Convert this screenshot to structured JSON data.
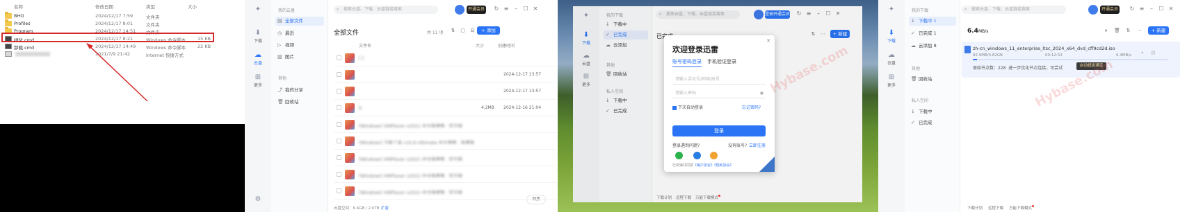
{
  "explorer": {
    "columns": [
      "名称",
      "修改日期",
      "类型",
      "大小"
    ],
    "rows": [
      {
        "name": "BHO",
        "date": "2024/12/17 7:59",
        "type": "文件夹",
        "size": "",
        "icon": "folder-icon"
      },
      {
        "name": "Profiles",
        "date": "2024/12/17 8:01",
        "type": "文件夹",
        "size": "",
        "icon": "folder-icon"
      },
      {
        "name": "Program",
        "date": "2024/12/17 14:51",
        "type": "文件夹",
        "size": "",
        "icon": "folder-icon"
      },
      {
        "name": "绿化.cmd",
        "date": "2024/12/17 8:21",
        "type": "Windows 命令脚本",
        "size": "15 KB",
        "icon": "cmd-icon"
      },
      {
        "name": "卸载.cmd",
        "date": "2024/12/17 14:49",
        "type": "Windows 命令脚本",
        "size": "22 KB",
        "icon": "cmd-icon"
      },
      {
        "name": "",
        "date": "2021/7/9 21:42",
        "type": "Internet 快捷方式",
        "size": "",
        "icon": "shortcut-icon"
      }
    ],
    "highlight_color": "#d62a2a"
  },
  "sidebar": {
    "items": [
      {
        "label": "下载",
        "icon": "download-icon"
      },
      {
        "label": "云盘",
        "icon": "cloud-icon"
      },
      {
        "label": "更多",
        "icon": "grid-icon"
      }
    ]
  },
  "cloud": {
    "nav_section": "我的云盘",
    "nav": [
      {
        "label": "全部文件",
        "icon": "folder-icon"
      },
      {
        "label": "最近",
        "icon": "clock-icon"
      },
      {
        "label": "视频",
        "icon": "video-icon"
      },
      {
        "label": "图片",
        "icon": "image-icon"
      }
    ],
    "nav_section2": "其他",
    "nav2": [
      {
        "label": "我的分享",
        "icon": "share-icon"
      },
      {
        "label": "回收站",
        "icon": "trash-icon"
      }
    ],
    "search_placeholder": "搜索云盘、下载、云盘链接搜索",
    "vip_label": "开通会员",
    "title": "全部文件",
    "count": "共 11 项",
    "add_label": "+ 添加",
    "col_name": "文件名",
    "col_size": "大小",
    "col_date": "创建时间",
    "files": [
      {
        "name": "[ ]",
        "size": "",
        "date": ""
      },
      {
        "name": "",
        "size": "",
        "date": "2024-12-17 13:57"
      },
      {
        "name": "",
        "size": "",
        "date": "2024-12-17 13:57"
      },
      {
        "name": "b",
        "size": "4.2MB",
        "date": "2024-12-16 21:04"
      },
      {
        "name": "[Windows] XMPlayer v2021 中文版便携 · 官方版",
        "size": "",
        "date": ""
      },
      {
        "name": "[Windows] 万能工具 v10.6 Ultimate 中文便携 · 免费版",
        "size": "",
        "date": ""
      },
      {
        "name": "[Windows] XMPlayer v2021 中文版便携 · 官方版",
        "size": "",
        "date": ""
      },
      {
        "name": "[Windows] XMPlayer v2021 中文版便携 · 官方版",
        "size": "",
        "date": ""
      },
      {
        "name": "[Windows] XMPlayer v2021 中文版便携 · 官方版",
        "size": "",
        "date": ""
      }
    ],
    "storage": "云盘空间：6.6GB / 2.0TB",
    "expand": "扩容",
    "up_label": "回顶"
  },
  "download_nav": {
    "section": "我的下载",
    "items": [
      {
        "label": "下载中",
        "count": "1",
        "icon": "arrow-down-icon"
      },
      {
        "label": "已完成",
        "count": "1",
        "icon": "check-circle-icon"
      },
      {
        "label": "云添加",
        "count": "8",
        "icon": "cloud-add-icon"
      }
    ],
    "other_section": "其他",
    "trash": "回收站",
    "private_section": "私人空间",
    "private_items": [
      {
        "label": "下载中",
        "icon": "arrow-down-icon"
      },
      {
        "label": "已完成",
        "icon": "check-circle-icon"
      }
    ]
  },
  "login": {
    "section_title": "已完成",
    "search_placeholder": "搜索云盘、下载、云盘链接搜索",
    "vip_label": "登录开通会员",
    "dialog_title": "欢迎登录迅雷",
    "tab_password": "账号密码登录",
    "tab_sms": "手机验证登录",
    "account_placeholder": "请输入手机号/邮箱/账号",
    "password_placeholder": "请输入密码",
    "auto_login": "下次自动登录",
    "forgot": "忘记密码?",
    "login_btn": "登录",
    "problem": "登录遇到问题?",
    "no_account": "没有账号?",
    "register": "立即注册",
    "agree_prefix": "已阅读并同意",
    "agreement1": "《用户协议》",
    "agreement2": "《隐私协议》",
    "footer": [
      "下载计划",
      "远程下载",
      "万能下载模式"
    ],
    "watermark": "Hybase.com"
  },
  "active_download": {
    "speed": "6.4",
    "speed_unit": "MB/s",
    "nav_counts": [
      "1",
      "1",
      "8"
    ],
    "file_name": "zh-cn_windows_11_enterprise_ltsc_2024_x64_dvd_cff9cd2d.iso",
    "size_progress": "92.9MB/4.82GB",
    "remaining": "00:12:53",
    "task_speed": "6.4MB/s",
    "progress_fraction": 0.02,
    "sources": "原始节点数：228",
    "more_sources": "进一步优化节点连接，可尝试",
    "accelerate": "启动超级通道",
    "vip_label": "开通会员",
    "add_label": "+ 新建",
    "footer": [
      "下载计划",
      "远程下载",
      "万能下载模式"
    ],
    "watermark": "Hybase.com"
  },
  "colors": {
    "accent": "#2a74f5",
    "vip_bg": "#1f1f1f",
    "vip_text": "#f0d49b"
  }
}
